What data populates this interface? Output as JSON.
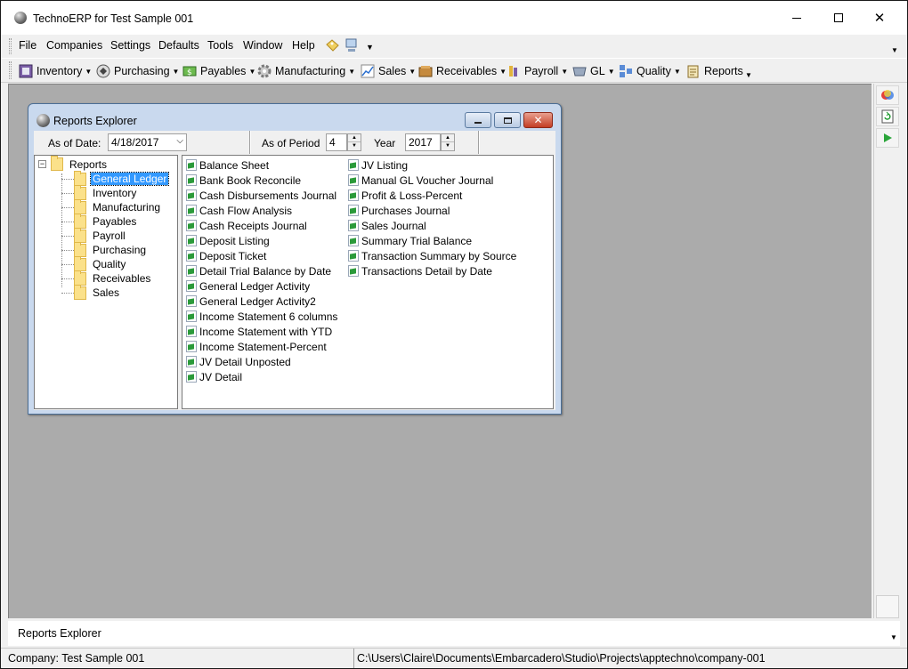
{
  "window": {
    "title": "TechnoERP for Test Sample 001"
  },
  "menu": [
    "File",
    "Companies",
    "Settings",
    "Defaults",
    "Tools",
    "Window",
    "Help"
  ],
  "toolbar": [
    {
      "label": "Inventory",
      "icon": "inventory-icon"
    },
    {
      "label": "Purchasing",
      "icon": "purchasing-icon"
    },
    {
      "label": "Payables",
      "icon": "payables-icon"
    },
    {
      "label": "Manufacturing",
      "icon": "gear-icon"
    },
    {
      "label": "Sales",
      "icon": "sales-chart-icon"
    },
    {
      "label": "Receivables",
      "icon": "receivables-icon"
    },
    {
      "label": "Payroll",
      "icon": "payroll-icon"
    },
    {
      "label": "GL",
      "icon": "gl-icon"
    },
    {
      "label": "Quality",
      "icon": "quality-icon"
    },
    {
      "label": "Reports",
      "icon": "reports-icon"
    }
  ],
  "reports_explorer": {
    "title": "Reports Explorer",
    "as_of_date_label": "As of Date:",
    "as_of_date_value": "4/18/2017",
    "as_of_period_label": "As of Period",
    "period_value": "4",
    "year_label": "Year",
    "year_value": "2017",
    "tree": {
      "root": "Reports",
      "children": [
        "General Ledger",
        "Inventory",
        "Manufacturing",
        "Payables",
        "Payroll",
        "Purchasing",
        "Quality",
        "Receivables",
        "Sales"
      ],
      "selected": "General Ledger"
    },
    "reports_col1": [
      "Balance Sheet",
      "Bank Book Reconcile",
      "Cash Disbursements Journal",
      "Cash Flow Analysis",
      "Cash Receipts Journal",
      "Deposit Listing",
      "Deposit Ticket",
      "Detail Trial Balance by Date",
      "General Ledger Activity",
      "General Ledger Activity2",
      "Income Statement 6 columns",
      "Income Statement with YTD",
      "Income Statement-Percent",
      "JV Detail Unposted",
      "JV Detail"
    ],
    "reports_col2": [
      "JV Listing",
      "Manual GL Voucher Journal",
      "Profit & Loss-Percent",
      "Purchases Journal",
      "Sales Journal",
      "Summary Trial Balance",
      "Transaction Summary by Source",
      "Transactions Detail by Date"
    ]
  },
  "bottom_tab": "Reports Explorer",
  "status": {
    "company": "Company: Test Sample 001",
    "path": "C:\\Users\\Claire\\Documents\\Embarcadero\\Studio\\Projects\\apptechno\\company-001"
  }
}
